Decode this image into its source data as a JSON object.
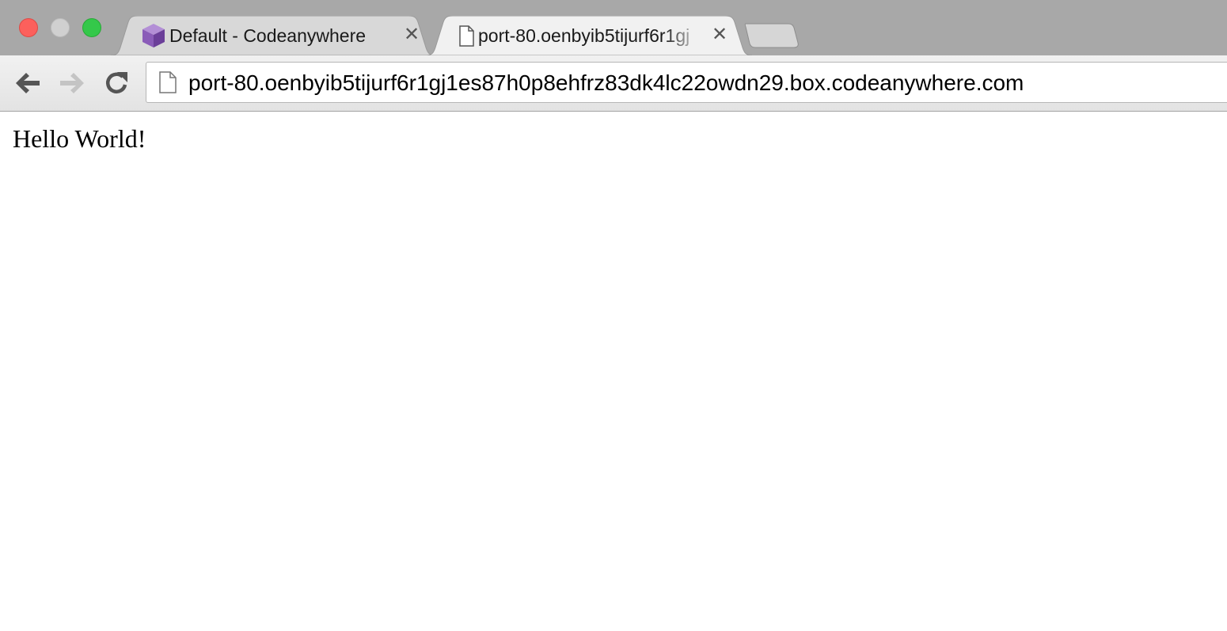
{
  "window": {
    "controls": [
      "close",
      "minimize",
      "maximize"
    ],
    "colors": {
      "close": "#fc605c",
      "minimize": "#d0d0d0",
      "maximize": "#34c84a"
    }
  },
  "tabs": [
    {
      "title": "Default - Codeanywhere",
      "icon": "codeanywhere-cube-icon",
      "active": false
    },
    {
      "title": "port-80.oenbyib5tijurf6r1gj",
      "icon": "page-icon",
      "active": true
    }
  ],
  "toolbar": {
    "back_icon": "back-arrow-icon",
    "forward_icon": "forward-arrow-icon",
    "reload_icon": "reload-icon",
    "address": "port-80.oenbyib5tijurf6r1gj1es87h0p8ehfrz83dk4lc22owdn29.box.codeanywhere.com"
  },
  "page": {
    "body_text": "Hello World!"
  }
}
